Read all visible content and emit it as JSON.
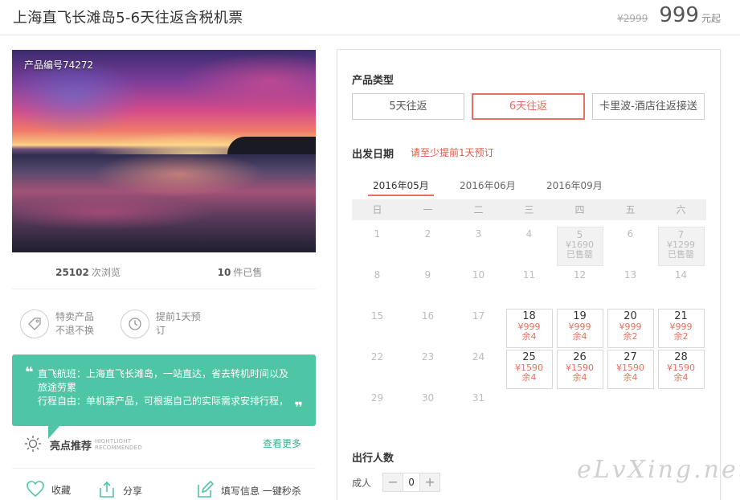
{
  "header": {
    "title": "上海直飞长滩岛5-6天往返含税机票",
    "old_price": "¥2999",
    "price": "999",
    "price_unit": "元起"
  },
  "photo": {
    "code_label": "产品编号74272"
  },
  "stats": {
    "views_count": "25102",
    "views_label": "次浏览",
    "sold_count": "10",
    "sold_label": "件已售"
  },
  "features": [
    {
      "icon": "tag-icon",
      "line1": "特卖产品",
      "line2": "不退不换"
    },
    {
      "icon": "clock-icon",
      "line1": "提前1天预",
      "line2": "订"
    }
  ],
  "promo": {
    "line1": "直飞航班：上海直飞长滩岛，一站直达，省去转机时间以及",
    "line2": "旅途劳累",
    "line3": "行程自由：单机票产品，可根据自己的实际需求安排行程，",
    "open_quote": "❝",
    "close_quote": "❞"
  },
  "highlight": {
    "title": "亮点推荐",
    "en_line1": "HIGHTLIGHT",
    "en_line2": "RECOMMENDED",
    "more": "查看更多"
  },
  "actions": {
    "favorite": "收藏",
    "share": "分享",
    "fill_info": "填写信息 一键秒杀"
  },
  "panel": {
    "product_type_title": "产品类型",
    "product_types": [
      {
        "label": "5天往返",
        "active": false
      },
      {
        "label": "6天往返",
        "active": true
      },
      {
        "label": "卡里波-酒店往返接送",
        "active": false
      }
    ],
    "date_title": "出发日期",
    "date_note": "请至少提前1天预订",
    "months": [
      "2016年05月",
      "2016年06月",
      "2016年09月"
    ],
    "weekdays": [
      "日",
      "一",
      "二",
      "三",
      "四",
      "五",
      "六"
    ],
    "weeks": [
      [
        {
          "d": "1"
        },
        {
          "d": "2"
        },
        {
          "d": "3"
        },
        {
          "d": "4"
        },
        {
          "d": "5",
          "status": "soldout",
          "price": "¥1690",
          "note": "已售罄"
        },
        {
          "d": "6"
        },
        {
          "d": "7",
          "status": "soldout",
          "price": "¥1299",
          "note": "已售罄"
        }
      ],
      [
        {
          "d": "8"
        },
        {
          "d": "9"
        },
        {
          "d": "10"
        },
        {
          "d": "11"
        },
        {
          "d": "12"
        },
        {
          "d": "13"
        },
        {
          "d": "14"
        }
      ],
      [
        {
          "d": "15"
        },
        {
          "d": "16"
        },
        {
          "d": "17"
        },
        {
          "d": "18",
          "status": "avail",
          "price": "¥999",
          "note": "余4"
        },
        {
          "d": "19",
          "status": "avail",
          "price": "¥999",
          "note": "余4"
        },
        {
          "d": "20",
          "status": "avail",
          "price": "¥999",
          "note": "余2"
        },
        {
          "d": "21",
          "status": "avail",
          "price": "¥999",
          "note": "余2"
        }
      ],
      [
        {
          "d": "22"
        },
        {
          "d": "23"
        },
        {
          "d": "24"
        },
        {
          "d": "25",
          "status": "avail",
          "price": "¥1590",
          "note": "余4"
        },
        {
          "d": "26",
          "status": "avail",
          "price": "¥1590",
          "note": "余4"
        },
        {
          "d": "27",
          "status": "avail",
          "price": "¥1590",
          "note": "余4"
        },
        {
          "d": "28",
          "status": "avail",
          "price": "¥1590",
          "note": "余4"
        }
      ],
      [
        {
          "d": "29"
        },
        {
          "d": "30"
        },
        {
          "d": "31"
        }
      ]
    ],
    "people_title": "出行人数",
    "adult_label": "成人",
    "adult_count": "0",
    "minus": "−",
    "plus": "+"
  },
  "watermark": "eLvXing.net",
  "colors": {
    "accent": "#e8705e",
    "promo_bg": "#4ec5a5",
    "link": "#3fae8e"
  }
}
